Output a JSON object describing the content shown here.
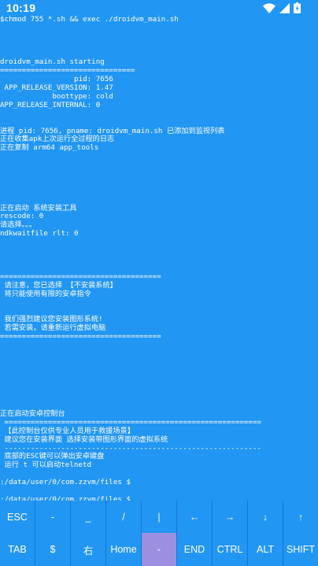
{
  "status_bar": {
    "time": "10:19",
    "icons": [
      "wifi-icon",
      "signal-icon",
      "battery-icon"
    ]
  },
  "terminal": {
    "lines": [
      "$chmod 755 *.sh && exec ./droidvm_main.sh",
      "",
      "",
      "",
      "",
      "droidvm_main.sh starting",
      "===============================",
      "                 pid: 7656",
      " APP_RELEASE_VERSION: 1.47",
      "            boottype: cold",
      "APP_RELEASE_INTERNAL: 0",
      "",
      "",
      "进程 pid: 7656, pname: droidvm_main.sh 已添加到监视列表",
      "正在收集apk上次运行全过程的日志",
      "正在复制 arm64 app_tools",
      "",
      "",
      "",
      "",
      "",
      "",
      "正在启动 系统安装工具",
      "rescode: 0",
      "请选择。。。",
      "ndkwaitfile rlt: 0",
      "",
      "",
      "",
      "",
      "=====================================",
      " 请注意，您已选择 【不安装系统】",
      " 将只能使用有限的安卓指令",
      "",
      "",
      " 我们强烈建议您安装图形系统!",
      " 若需安装，请重新运行虚拟电脑",
      "=====================================",
      "",
      "",
      "",
      "",
      "",
      "",
      "",
      "",
      "正在启动安卓控制台",
      " ===========================================================",
      " 【此控制台仅供专业人员用于救援场景】",
      " 建议您在安装界面 选择安装带图形界面的虚拟系统",
      " -----------------------------------------------------------",
      " 底部的ESC键可以弹出安卓键盘",
      " 运行 t 可以启动telnetd",
      "",
      ":/data/user/0/com.zzvm/files $",
      "",
      ":/data/user/0/com.zzvm/files $"
    ]
  },
  "extra_keys": {
    "row1": [
      "ESC",
      "-",
      "_",
      "/",
      "|",
      "←",
      "→",
      "↓",
      "↑"
    ],
    "row2": [
      "TAB",
      "$",
      "右",
      "Home",
      "-",
      "END",
      "CTRL",
      "ALT",
      "SHIFT"
    ]
  },
  "colors": {
    "background": "#2196F3",
    "keys_background": "#1976D2",
    "active_key": "#9C8FE0",
    "text": "#ffffff"
  }
}
